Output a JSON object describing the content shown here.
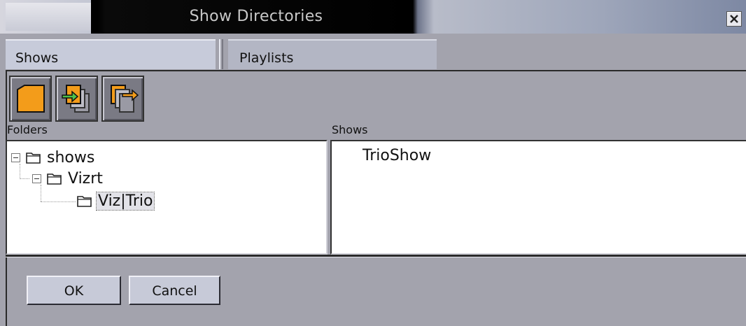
{
  "window": {
    "title": "Show Directories",
    "close_icon": "close-icon"
  },
  "tabs": [
    {
      "label": "Shows",
      "active": true
    },
    {
      "label": "Playlists",
      "active": false
    }
  ],
  "toolbar": {
    "buttons": [
      {
        "icon": "new-folder-icon"
      },
      {
        "icon": "import-icon"
      },
      {
        "icon": "export-icon"
      }
    ]
  },
  "folders": {
    "label": "Folders",
    "tree": [
      {
        "label": "shows",
        "expanded": true,
        "depth": 0
      },
      {
        "label": "Vizrt",
        "expanded": true,
        "depth": 1
      },
      {
        "label": "Viz|Trio",
        "selected": true,
        "depth": 2
      }
    ]
  },
  "shows": {
    "label": "Shows",
    "items": [
      "TrioShow"
    ]
  },
  "footer": {
    "ok_label": "OK",
    "cancel_label": "Cancel"
  },
  "colors": {
    "accent": "#f39c1a",
    "window_bg": "#a3a3ad",
    "tab_active": "#c7cbda"
  }
}
